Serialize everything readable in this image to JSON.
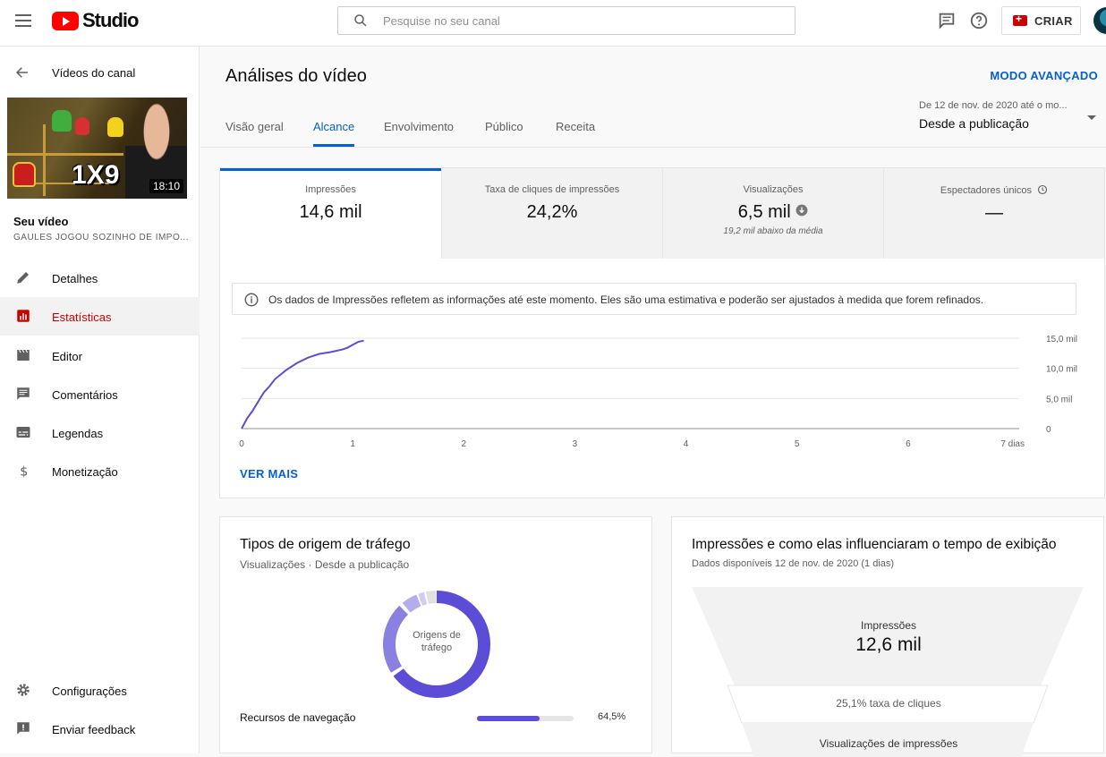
{
  "app": {
    "logo_text": "Studio"
  },
  "search": {
    "placeholder": "Pesquise no seu canal"
  },
  "header": {
    "create_label": "CRIAR"
  },
  "sidebar": {
    "back_label": "Vídeos do canal",
    "thumbnail": {
      "overlay_text": "1X9",
      "duration": "18:10"
    },
    "your_video_label": "Seu vídeo",
    "video_title": "GAULES JOGOU SOZINHO DE IMPO...",
    "items": [
      {
        "label": "Detalhes",
        "icon": "pencil-icon",
        "active": false
      },
      {
        "label": "Estatísticas",
        "icon": "analytics-icon",
        "active": true
      },
      {
        "label": "Editor",
        "icon": "clapper-icon",
        "active": false
      },
      {
        "label": "Comentários",
        "icon": "comment-icon",
        "active": false
      },
      {
        "label": "Legendas",
        "icon": "subtitles-icon",
        "active": false
      },
      {
        "label": "Monetização",
        "icon": "dollar-icon",
        "active": false
      }
    ],
    "bottom_items": [
      {
        "label": "Configurações",
        "icon": "gear-icon"
      },
      {
        "label": "Enviar feedback",
        "icon": "feedback-icon"
      }
    ]
  },
  "main": {
    "title": "Análises do vídeo",
    "advanced_mode": "MODO AVANÇADO",
    "tabs": [
      {
        "label": "Visão geral",
        "active": false
      },
      {
        "label": "Alcance",
        "active": true
      },
      {
        "label": "Envolvimento",
        "active": false
      },
      {
        "label": "Público",
        "active": false
      },
      {
        "label": "Receita",
        "active": false
      }
    ],
    "date_range": {
      "detail": "De 12 de nov. de 2020 até o mo...",
      "selected": "Desde a publicação"
    }
  },
  "metrics": [
    {
      "label": "Impressões",
      "value": "14,6 mil",
      "sub": "",
      "active": true
    },
    {
      "label": "Taxa de cliques de impressões",
      "value": "24,2%",
      "sub": "",
      "active": false
    },
    {
      "label": "Visualizações",
      "value": "6,5 mil",
      "sub": "19,2 mil abaixo da média",
      "active": false
    },
    {
      "label": "Espectadores únicos",
      "value": "—",
      "sub": "",
      "active": false
    }
  ],
  "info": {
    "text": "Os dados de Impressões refletem as informações até este momento. Eles são uma estimativa e poderão ser ajustados à medida que forem refinados."
  },
  "chart_data": {
    "type": "line",
    "x": [
      0,
      0.05,
      0.1,
      0.15,
      0.2,
      0.25,
      0.3,
      0.4,
      0.5,
      0.6,
      0.7,
      0.8,
      0.9,
      0.95,
      1.0,
      1.05,
      1.1
    ],
    "series": [
      {
        "values": [
          0,
          1.7,
          3.0,
          4.5,
          6.0,
          7.0,
          8.2,
          9.7,
          10.9,
          11.8,
          12.4,
          12.7,
          13.1,
          13.4,
          13.9,
          14.4,
          14.6
        ]
      }
    ],
    "x_ticks": [
      "0",
      "1",
      "2",
      "3",
      "4",
      "5",
      "6",
      "7 dias"
    ],
    "y_ticks": [
      "0",
      "5,0 mil",
      "10,0 mil",
      "15,0 mil"
    ],
    "xlim": [
      0,
      7
    ],
    "ylim": [
      0,
      15
    ],
    "color": "#5c4dd7"
  },
  "see_more": "VER MAIS",
  "traffic": {
    "title": "Tipos de origem de tráfego",
    "subtitle": "Visualizações · Desde a publicação",
    "donut_center": "Origens de tráfego",
    "rows": [
      {
        "label": "Recursos de navegação",
        "value": "64,5%",
        "fraction": 0.645
      }
    ]
  },
  "funnel": {
    "title": "Impressões e como elas influenciaram o tempo de exibição",
    "subtitle": "Dados disponíveis 12 de nov. de 2020 (1 dias)",
    "impressions_label": "Impressões",
    "impressions_value": "12,6 mil",
    "ctr_text": "25,1% taxa de cliques",
    "next_label": "Visualizações de impressões"
  },
  "colors": {
    "accent": "#065fd4",
    "brand_red": "#ff0000",
    "series": "#5c4dd7"
  }
}
